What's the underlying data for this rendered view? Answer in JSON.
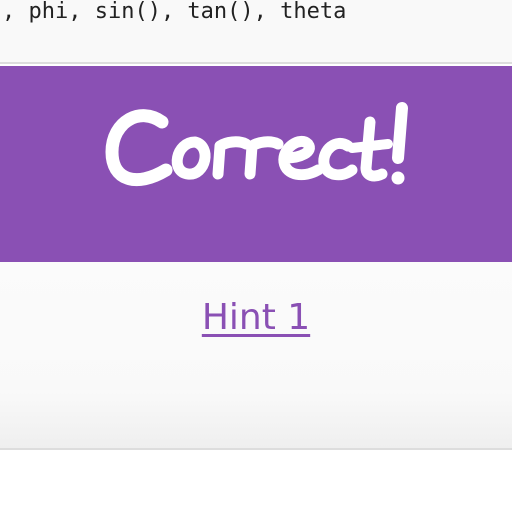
{
  "header": {
    "functions_text": ", phi, sin(), tan(), theta"
  },
  "banner": {
    "text": "Correct!",
    "background_color": "#8a50b4",
    "text_color": "#ffffff"
  },
  "hint": {
    "label": "Hint 1",
    "color": "#8a50b4"
  }
}
